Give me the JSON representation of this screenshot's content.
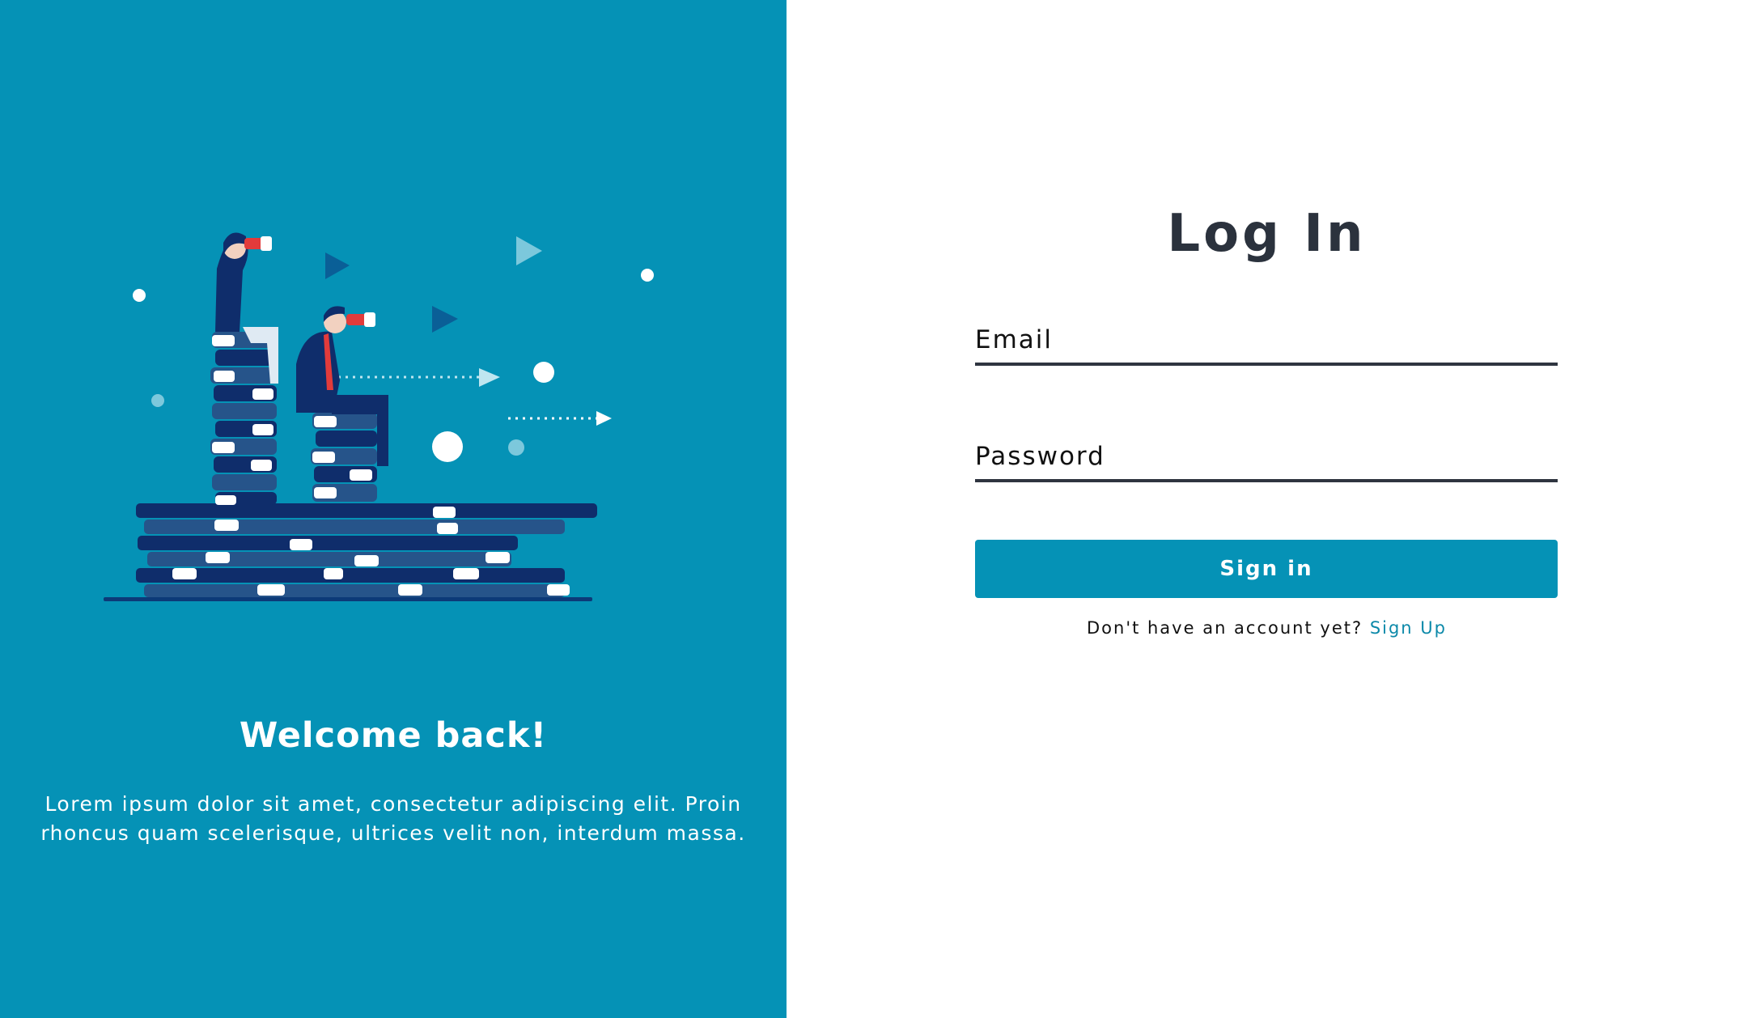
{
  "welcome_panel": {
    "heading": "Welcome back!",
    "body": "Lorem ipsum dolor sit amet, consectetur adipiscing elit. Proin rhoncus quam scelerisque, ultrices velit non, interdum massa.",
    "illustration": "people-on-books-with-binoculars-illustration",
    "background_color": "#0592b6"
  },
  "login": {
    "title": "Log In",
    "email_placeholder": "Email",
    "email_value": "",
    "password_placeholder": "Password",
    "password_value": "",
    "submit_label": "Sign in",
    "signup_prompt": "Don't have an account yet?",
    "signup_link": "Sign Up",
    "accent_color": "#0592b6",
    "text_color": "#2b323d"
  }
}
